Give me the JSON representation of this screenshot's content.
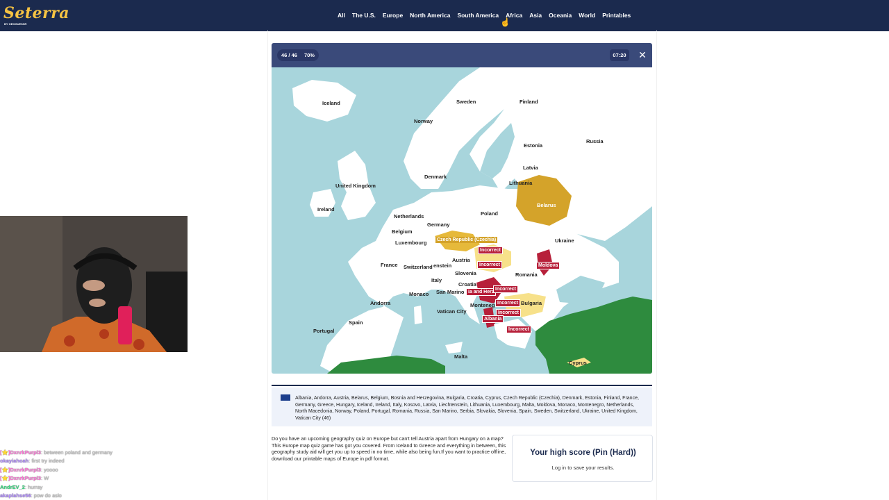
{
  "header": {
    "logo": "Seterra",
    "logo_sub": "BY GEOGUESSR",
    "nav": [
      "All",
      "The U.S.",
      "Europe",
      "North America",
      "South America",
      "Africa",
      "Asia",
      "Oceania",
      "World",
      "Printables"
    ]
  },
  "quiz": {
    "progress": "46 / 46",
    "percent": "70%",
    "timer": "07:20",
    "close_icon": "close-icon"
  },
  "map": {
    "labels": {
      "iceland": "Iceland",
      "sweden": "Sweden",
      "finland": "Finland",
      "norway": "Norway",
      "russia": "Russia",
      "estonia": "Estonia",
      "latvia": "Latvia",
      "lithuania": "Lithuania",
      "denmark": "Denmark",
      "united_kingdom": "United Kingdom",
      "ireland": "Ireland",
      "netherlands": "Netherlands",
      "belgium": "Belgium",
      "luxembourg": "Luxembourg",
      "germany": "Germany",
      "poland": "Poland",
      "belarus": "Belarus",
      "ukraine": "Ukraine",
      "czech": "Czech Republic (Czechia)",
      "france": "France",
      "switzerland": "Switzerland",
      "liechtenstein": "enstein",
      "austria": "Austria",
      "moldova": "Moldova",
      "slovenia": "Slovenia",
      "romania": "Romania",
      "italy": "Italy",
      "croatia": "Croatia",
      "bosnia": "ia and Herz",
      "monaco": "Monaco",
      "san_marino": "San Marino",
      "andorra": "Andorra",
      "montenegro": "Montenegr",
      "bulgaria": "Bulgaria",
      "vatican": "Vatican City",
      "spain": "Spain",
      "albania": "Albania",
      "portugal": "Portugal",
      "malta": "Malta",
      "cyprus": "Cyprus"
    },
    "incorrect_label": "Incorrect"
  },
  "countries_list": "Albania, Andorra, Austria, Belarus, Belgium, Bosnia and Herzegovina, Bulgaria, Croatia, Cyprus, Czech Republic (Czechia), Denmark, Estonia, Finland, France, Germany, Greece, Hungary, Iceland, Ireland, Italy, Kosovo, Latvia, Liechtenstein, Lithuania, Luxembourg, Malta, Moldova, Monaco, Montenegro, Netherlands, North Macedonia, Norway, Poland, Portugal, Romania, Russia, San Marino, Serbia, Slovakia, Slovenia, Spain, Sweden, Switzerland, Ukraine, United Kingdom, Vatican City (46)",
  "description": "Do you have an upcoming geography quiz on Europe but can't tell Austria apart from Hungary on a map? This Europe map quiz game has got you covered. From Iceland to Greece and everything in between, this geography study aid will get you up to speed in no time, while also being fun.If you want to practice offline, download our printable maps of Europe in pdf format.",
  "score_card": {
    "title": "Your high score (Pin (Hard))",
    "subtitle": "Log in to save your results."
  },
  "chat": [
    {
      "user": "[⭐]DxnrkPurpl3",
      "msg": "between poland and germany",
      "color": "#ff7ad9"
    },
    {
      "user": "okayiahoah",
      "msg": "first try indeed",
      "color": "#b18cff"
    },
    {
      "user": "[⭐]DxnrkPurpl3",
      "msg": "yoooo",
      "color": "#ff7ad9"
    },
    {
      "user": "[⭐]DxnrkPurpl3",
      "msg": "W",
      "color": "#ff7ad9"
    },
    {
      "user": "AndrEV_2",
      "msg": "hurray",
      "color": "#3ddc84"
    },
    {
      "user": "akaplahse56",
      "msg": "pow do aslo",
      "color": "#b18cff"
    }
  ],
  "colors": {
    "nav_bg": "#1b2a4e",
    "logo": "#f6c343",
    "incorrect": "#b7203a",
    "partial": "#d4a32a",
    "correct_land": "#2e8b3e",
    "sea": "#a8d5dc",
    "land": "#ffffff"
  }
}
